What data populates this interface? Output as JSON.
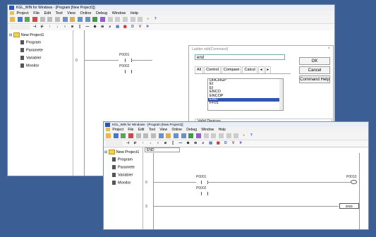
{
  "back_window": {
    "title": "KGL_WIN for Windows - [Program [New Project1]]",
    "menu": [
      "Project",
      "File",
      "Edit",
      "Tool",
      "View",
      "Online",
      "Debug",
      "Window",
      "Help"
    ],
    "tree": {
      "root": "New Project1",
      "items": [
        "Program",
        "Paramete",
        "Variable/",
        "Monitor"
      ]
    },
    "ladder": {
      "rung_number": "0",
      "contact1": "P0001",
      "contact2": "P0002"
    },
    "dialog": {
      "title": "Ladder edit(Command)",
      "input_value": "end",
      "tabs": [
        "All",
        "Control",
        "Compare",
        "Calcul"
      ],
      "list": [
        "DHCHGP",
        "EI",
        "EI",
        "ENCO",
        "ENCOP",
        "END",
        "FF01"
      ],
      "selected": "END",
      "ok": "OK",
      "cancel": "Cancel",
      "help": "Command Help",
      "valid_devices": "Valid Devices"
    }
  },
  "front_window": {
    "title": "KGL_WIN for Windows - [Program [New Project1]]",
    "menu": [
      "Project",
      "File",
      "Edit",
      "Tool",
      "View",
      "Online",
      "Debug",
      "Window",
      "Help"
    ],
    "tree": {
      "root": "New Project1",
      "items": [
        "Program",
        "Paramete",
        "Variable/",
        "Monitor"
      ]
    },
    "cell_label": "END",
    "ladder": {
      "rung0": "0",
      "rung3": "3",
      "contact1": "P0001",
      "contact2": "P0002",
      "coil": "P0010",
      "end_label": "END"
    }
  }
}
